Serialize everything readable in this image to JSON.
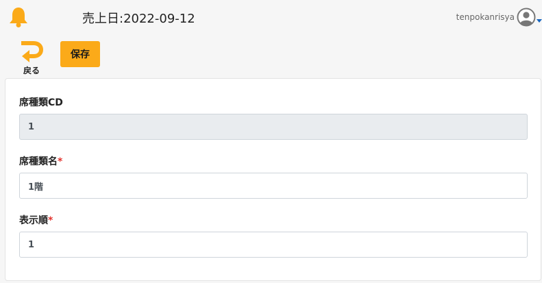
{
  "header": {
    "sales_date_label": "売上日:2022-09-12",
    "username": "tenpokanrisya",
    "icons": {
      "notification": "bell-icon",
      "user": "user-avatar-icon",
      "menu": "chevron-down-icon"
    },
    "accent_color": "#fbaa19"
  },
  "toolbar": {
    "back_label": "戻る",
    "save_label": "保存"
  },
  "form": {
    "seat_type_cd": {
      "label": "席種類CD",
      "value": "1",
      "readonly": true
    },
    "seat_type_name": {
      "label": "席種類名",
      "required_mark": "*",
      "value": "1階"
    },
    "display_order": {
      "label": "表示順",
      "required_mark": "*",
      "value": "1"
    }
  }
}
